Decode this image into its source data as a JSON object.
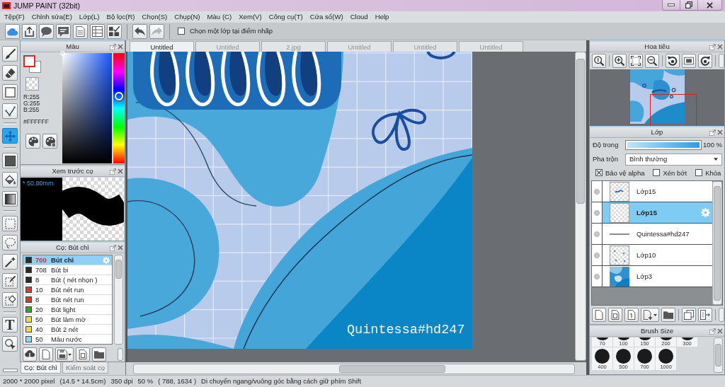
{
  "window": {
    "title": "JUMP PAINT (32bit)"
  },
  "menu": [
    "Tệp(F)",
    "Chỉnh sửa(E)",
    "Lớp(L)",
    "Bộ lọc(R)",
    "Chọn(S)",
    "Chụp(N)",
    "Màu (C)",
    "Xem(V)",
    "Công cụ(T)",
    "Cửa sổ(W)",
    "Cloud",
    "Help"
  ],
  "toolbar": {
    "groups": [
      [
        {
          "kind": "cloud"
        },
        {
          "kind": "share"
        },
        {
          "kind": "speech"
        },
        {
          "kind": "comment"
        },
        {
          "kind": "document"
        },
        {
          "kind": "list"
        },
        {
          "kind": "checklist"
        }
      ],
      [
        {
          "kind": "undo",
          "disabled": false
        },
        {
          "kind": "redo",
          "disabled": true
        }
      ]
    ],
    "pick_layer": {
      "label": "Chọn một lớp tại điểm nhấp",
      "checked": false
    }
  },
  "tool_groups": [
    [
      {
        "kind": "pen",
        "selected": false
      },
      {
        "kind": "eraser",
        "selected": false
      },
      {
        "kind": "rectangle",
        "selected": false
      },
      {
        "kind": "polyline",
        "selected": false
      }
    ],
    [
      {
        "kind": "move",
        "selected": true
      }
    ],
    [
      {
        "kind": "fill",
        "selected": false
      },
      {
        "kind": "bucket",
        "selected": false
      },
      {
        "kind": "gradient",
        "selected": false
      }
    ],
    [
      {
        "kind": "select_rect",
        "selected": false
      },
      {
        "kind": "lasso",
        "selected": false
      },
      {
        "kind": "wand",
        "selected": false
      },
      {
        "kind": "select_pen",
        "selected": false
      },
      {
        "kind": "select_eraser",
        "selected": false
      }
    ],
    [
      {
        "kind": "text",
        "label": "T",
        "selected": false
      },
      {
        "kind": "object",
        "selected": false
      }
    ]
  ],
  "color_panel": {
    "title": "Màu",
    "red": "R:255",
    "green": "G:255",
    "blue": "B:255",
    "hex": "#FFFFFF",
    "hue": {
      "level": 0.61
    }
  },
  "brush_preview": {
    "title": "Xem trước cọ",
    "size": "* 50.80mm"
  },
  "brush_panel": {
    "title": "Cọ: Bút chì",
    "brushes": [
      {
        "color": "#2b2b2b",
        "size": "700",
        "name": "Bút chì",
        "selected": true
      },
      {
        "color": "#2b2b2b",
        "size": "708",
        "name": "Bút bi",
        "selected": false
      },
      {
        "color": "#2b2b2b",
        "size": "8",
        "name": "Bút ( nét nhọn )",
        "selected": false
      },
      {
        "color": "#e83030",
        "size": "10",
        "name": "Bút nét run",
        "selected": false
      },
      {
        "color": "#e83030",
        "size": "8",
        "name": "Bút nét run",
        "selected": false
      },
      {
        "color": "#22b022",
        "size": "20",
        "name": "Bút light",
        "selected": false
      },
      {
        "color": "#f0e020",
        "size": "50",
        "name": "Bút làm mờ",
        "selected": false
      },
      {
        "color": "#f0e020",
        "size": "40",
        "name": "Bút 2 nét",
        "selected": false
      },
      {
        "color": "#8ad8f0",
        "size": "50",
        "name": "Màu nước",
        "selected": false
      }
    ],
    "tools": [
      {
        "kind": "download"
      },
      {
        "kind": "new"
      },
      {
        "kind": "save"
      },
      {
        "kind": "script"
      },
      {
        "kind": "folder"
      }
    ],
    "tabs": [
      {
        "label": "Cọ: Bút chì",
        "selected": true,
        "disabled": false
      },
      {
        "label": "Kiểm soát cọ",
        "selected": false,
        "disabled": true
      }
    ]
  },
  "document_tabs": [
    {
      "label": "Untitled",
      "selected": true
    },
    {
      "label": "Untitled",
      "selected": false
    },
    {
      "label": "2.jpg",
      "selected": false
    },
    {
      "label": "Untitled",
      "selected": false
    },
    {
      "label": "Untitled",
      "selected": false
    },
    {
      "label": "Untitled",
      "selected": false
    }
  ],
  "canvas": {
    "text": "Quintessa#hd247"
  },
  "navigator": {
    "title": "Hoa tiêu",
    "buttons": [
      [
        {
          "kind": "actual_size"
        }
      ],
      [
        {
          "kind": "zoom_in"
        },
        {
          "kind": "fit"
        },
        {
          "kind": "zoom_out"
        }
      ],
      [
        {
          "kind": "rotate_left"
        },
        {
          "kind": "reset"
        },
        {
          "kind": "rotate_right"
        }
      ]
    ]
  },
  "layers": {
    "title": "Lớp",
    "opacity_label": "Độ trong",
    "opacity": {
      "level": 1
    },
    "opacity_reading": "100 %",
    "blend_label": "Pha trộn",
    "blend": "Bình thường",
    "options": [
      {
        "label": "Bảo vệ alpha",
        "checked": true
      },
      {
        "label": "Xén bớt",
        "checked": false
      },
      {
        "label": "Khóa",
        "checked": false
      }
    ],
    "items": [
      {
        "name": "Lớp15",
        "kind": "sketch",
        "selected": false
      },
      {
        "name": "Lớp15",
        "kind": "blank",
        "selected": true
      },
      {
        "name": "Quintessa#hd247",
        "kind": "text",
        "selected": false
      },
      {
        "name": "Lớp10",
        "kind": "marks",
        "selected": false
      },
      {
        "name": "Lớp3",
        "kind": "artwork",
        "selected": false
      }
    ],
    "tools": [
      [
        {
          "kind": "new"
        },
        {
          "kind": "page_box"
        },
        {
          "kind": "page_line"
        },
        {
          "kind": "add"
        },
        {
          "kind": "folder"
        }
      ],
      [
        {
          "kind": "copy"
        },
        {
          "kind": "merge"
        }
      ]
    ]
  },
  "brush_size": {
    "title": "Brush Size",
    "rows": [
      [
        "70",
        "100",
        "150",
        "200",
        "300"
      ],
      [
        "400",
        "500",
        "700",
        "1000"
      ]
    ]
  },
  "status_bar": [
    "2000 * 2000 pixel",
    "(14.5 * 14.5cm)",
    "350 dpi",
    "50 %",
    "( 788, 1634 )",
    "Di chuyển ngang/vuông góc bằng cách giữ phím Shift"
  ]
}
